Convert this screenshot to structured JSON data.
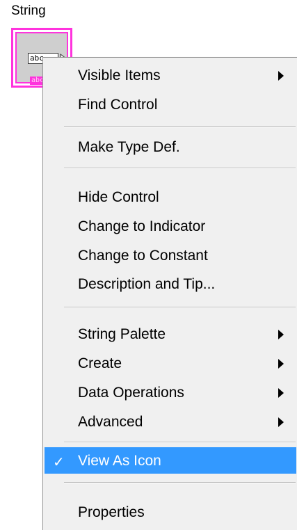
{
  "terminal": {
    "label": "String",
    "box_text": "abc",
    "tag_text": "abc",
    "accent_color": "#ff33dd"
  },
  "menu": {
    "items": [
      {
        "label": "Visible Items",
        "submenu": true,
        "icon": "chevron-right-icon"
      },
      {
        "label": "Find Control"
      },
      {
        "label": "Make Type Def."
      },
      {
        "label": "Hide Control"
      },
      {
        "label": "Change to Indicator"
      },
      {
        "label": "Change to Constant"
      },
      {
        "label": "Description and Tip..."
      },
      {
        "label": "String Palette",
        "submenu": true,
        "icon": "chevron-right-icon"
      },
      {
        "label": "Create",
        "submenu": true,
        "icon": "chevron-right-icon"
      },
      {
        "label": "Data Operations",
        "submenu": true,
        "icon": "chevron-right-icon"
      },
      {
        "label": "Advanced",
        "submenu": true,
        "icon": "chevron-right-icon"
      },
      {
        "label": "View As Icon",
        "checked": true,
        "selected": true,
        "check_glyph": "✓",
        "icon": "checkmark-icon"
      },
      {
        "label": "Properties"
      }
    ],
    "highlight_color": "#3399ff"
  }
}
